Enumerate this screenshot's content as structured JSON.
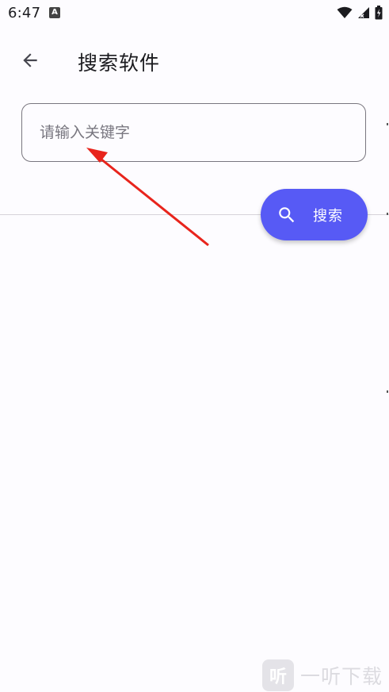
{
  "status_bar": {
    "time": "6:47",
    "app_icon_letter": "A",
    "icons": [
      "wifi-icon",
      "signal-icon",
      "battery-icon"
    ]
  },
  "app_bar": {
    "back_icon": "arrow-left-icon",
    "title": "搜索软件"
  },
  "search": {
    "placeholder": "请输入关键字",
    "value": ""
  },
  "fab": {
    "icon": "search-icon",
    "label": "搜索",
    "color": "#575af5"
  },
  "annotation": {
    "type": "arrow",
    "color": "#e8241c"
  },
  "watermark": {
    "logo_glyph": "听",
    "text": "一听下载"
  },
  "colors": {
    "background": "#fdfcff",
    "accent": "#575af5",
    "outline": "#79767f"
  }
}
